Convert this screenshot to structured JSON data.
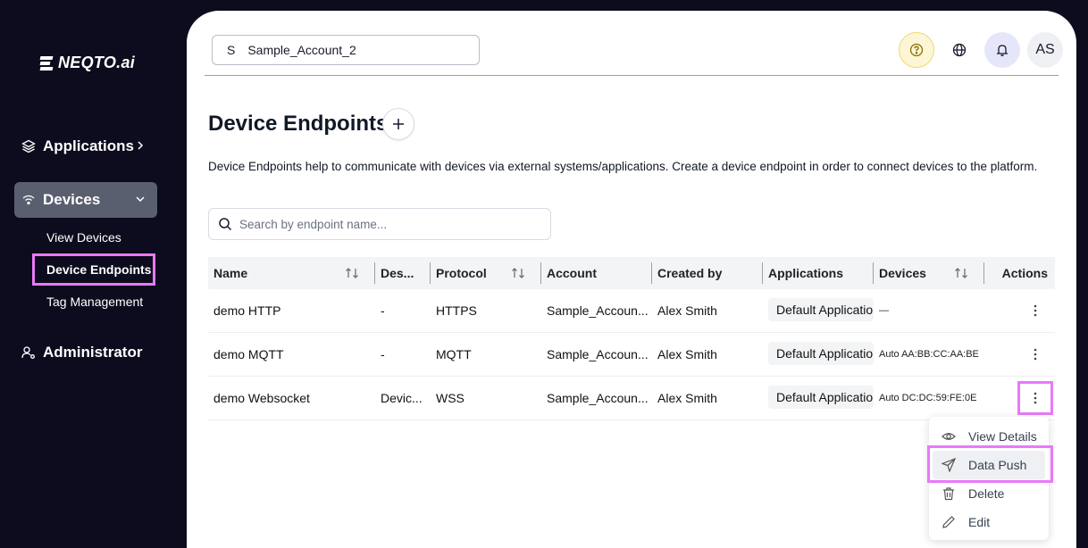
{
  "brand": {
    "name": "NEQTO.ai"
  },
  "sidebar": {
    "applications": "Applications",
    "devices": "Devices",
    "sub": {
      "view_devices": "View Devices",
      "device_endpoints": "Device Endpoints",
      "tag_management": "Tag Management"
    },
    "administrator": "Administrator"
  },
  "header": {
    "account_letter": "S",
    "account_name": "Sample_Account_2",
    "avatar_initials": "AS"
  },
  "page": {
    "title": "Device Endpoints",
    "description": "Device Endpoints help to communicate with devices via external systems/applications. Create a device endpoint in order to connect devices to the platform.",
    "search_placeholder": "Search by endpoint name..."
  },
  "table": {
    "columns": [
      "Name",
      "Des...",
      "Protocol",
      "Account",
      "Created by",
      "Applications",
      "Devices",
      "Actions"
    ],
    "rows": [
      {
        "name": "demo HTTP",
        "desc": "-",
        "protocol": "HTTPS",
        "account": "Sample_Accoun...",
        "created_by": "Alex Smith",
        "application": "Default Applicatio",
        "devices": "—"
      },
      {
        "name": "demo MQTT",
        "desc": "-",
        "protocol": "MQTT",
        "account": "Sample_Accoun...",
        "created_by": "Alex Smith",
        "application": "Default Applicatio",
        "devices": "Auto AA:BB:CC:AA:BE"
      },
      {
        "name": "demo Websocket",
        "desc": "Devic...",
        "protocol": "WSS",
        "account": "Sample_Accoun...",
        "created_by": "Alex Smith",
        "application": "Default Applicatio",
        "devices": "Auto DC:DC:59:FE:0E"
      }
    ]
  },
  "menu": {
    "view_details": "View Details",
    "data_push": "Data Push",
    "delete": "Delete",
    "edit": "Edit"
  },
  "colors": {
    "highlight": "#e879f9",
    "sidebar_bg": "#0d0b1e",
    "active_nav": "#5a5f70"
  }
}
